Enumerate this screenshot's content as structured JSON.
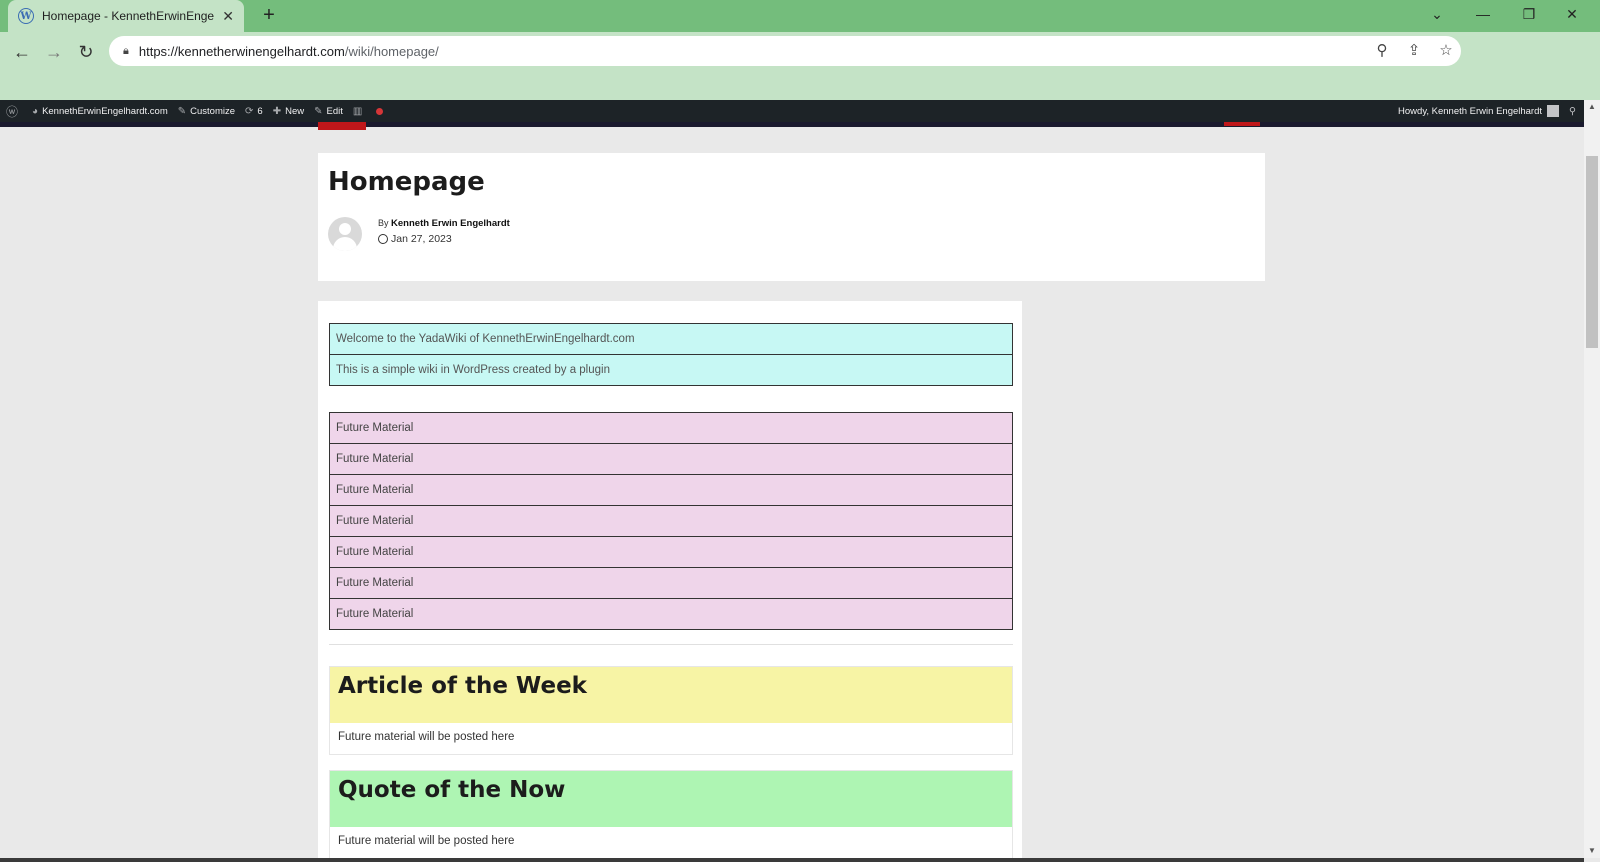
{
  "browser": {
    "tab_title": "Homepage - KennethErwinEngelhardt.com",
    "tab_icon_letter": "W",
    "url_host": "https://kennetherwinengelhardt.com",
    "url_path": "/wiki/homepage/",
    "colors": {
      "tabstrip": "#74bd7c",
      "toolbar": "#c4e3c6"
    }
  },
  "adminbar": {
    "site_name": "KennethErwinEngelhardt.com",
    "customize": "Customize",
    "updates_count": "6",
    "new_label": "New",
    "edit_label": "Edit",
    "howdy": "Howdy, Kenneth Erwin Engelhardt"
  },
  "page": {
    "title": "Homepage",
    "by_prefix": "By",
    "author": "Kenneth Erwin Engelhardt",
    "date": "Jan 27, 2023"
  },
  "welcome_table": [
    "Welcome to the YadaWiki of KennethErwinEngelhardt.com",
    "This is a simple wiki in WordPress created by a plugin"
  ],
  "future_table": [
    "Future Material",
    "Future Material",
    "Future Material",
    "Future Material",
    "Future Material",
    "Future Material",
    "Future Material"
  ],
  "features": [
    {
      "heading": "Article of the Week",
      "body": "Future material will be posted here",
      "color": "#f7f4a5"
    },
    {
      "heading": "Quote of the Now",
      "body": "Future material will be posted here",
      "color": "#aef5b3"
    }
  ]
}
